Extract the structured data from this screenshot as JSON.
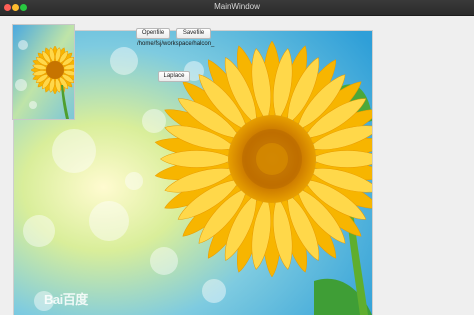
{
  "window": {
    "title": "MainWindow",
    "controls": [
      "close",
      "minimize",
      "maximize"
    ]
  },
  "toolbar": {
    "open_label": "Openfile",
    "save_label": "Savefile",
    "path_text": "/home/fsj/workspace/halcon_",
    "laplace_label": "Laplace"
  },
  "images": {
    "main_image": "sunflower-photo",
    "thumbnail": "sunflower-photo-thumbnail",
    "watermark": "Bai百度"
  },
  "colors": {
    "petal": "#f7b500",
    "petal_light": "#ffd84a",
    "center": "#c97a00",
    "sky": "#5fb7e5",
    "leaf": "#3a9b3a"
  }
}
